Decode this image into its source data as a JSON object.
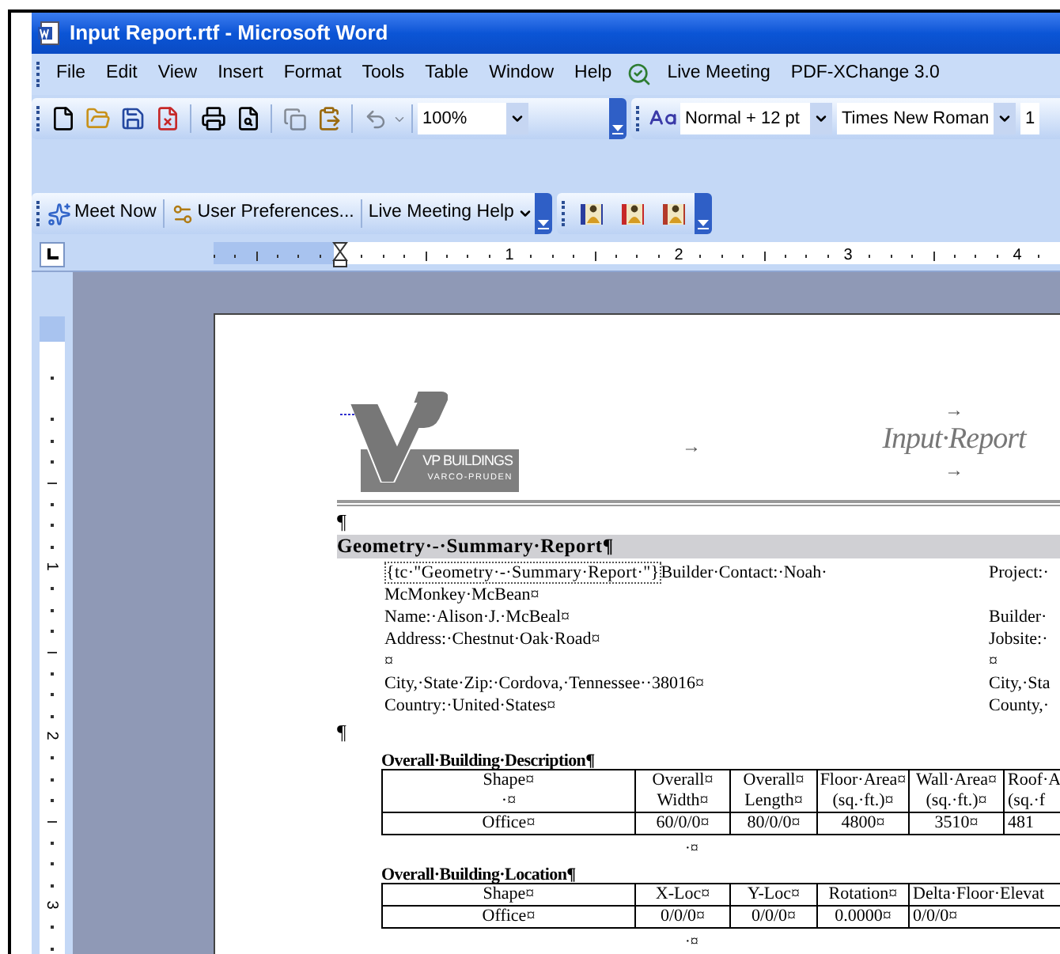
{
  "window": {
    "title": "Input Report.rtf - Microsoft Word"
  },
  "menu": [
    "File",
    "Edit",
    "View",
    "Insert",
    "Format",
    "Tools",
    "Table",
    "Window",
    "Help"
  ],
  "menu_extras": [
    "Live Meeting",
    "PDF-XChange 3.0"
  ],
  "standard_toolbar": {
    "copy_disabled": true,
    "undo_disabled": true,
    "zoom": "100%"
  },
  "formatting_toolbar": {
    "style": "Normal + 12 pt",
    "font": "Times New Roman",
    "font_size": "1"
  },
  "live_meeting_toolbar": {
    "buttons": [
      {
        "label": "Meet Now",
        "kind": "meet"
      },
      {
        "label": "User Preferences...",
        "kind": "preferences"
      },
      {
        "label": "Live Meeting Help",
        "kind": "menu"
      }
    ]
  },
  "ruler": {
    "numbers": [
      "1",
      "2",
      "3",
      "4"
    ]
  },
  "vertical_ruler": {
    "numbers": [
      "1",
      "2",
      "3"
    ]
  },
  "document": {
    "logo": {
      "name": "VP BUILDINGS",
      "tagline": "VARCO-PRUDEN"
    },
    "header": {
      "title": "Input·Report",
      "tab_marks": [
        "→",
        "→",
        "→"
      ]
    },
    "blocks": [
      {
        "kind": "mark",
        "text": "¶"
      },
      {
        "kind": "heading",
        "text": "Geometry·-·Summary·Report¶"
      },
      {
        "kind": "info",
        "field_code": "{tc·\"Geometry·-·Summary·Report·\"}",
        "rows": [
          {
            "left": "Builder·Contact:·Noah·",
            "right": "Project:·"
          },
          {
            "left": "McMonkey·McBean¤"
          },
          {
            "left": "Name:·Alison·J.·McBeal¤",
            "right": "Builder·"
          },
          {
            "left": "Address:·Chestnut·Oak·Road¤",
            "right": "Jobsite:·"
          },
          {
            "left": "¤",
            "right": "¤"
          },
          {
            "left": "City,·State·Zip:·Cordova,·Tennessee··38016¤",
            "right": "City,·Sta"
          },
          {
            "left": "Country:·United·States¤",
            "right": "County,·"
          }
        ]
      },
      {
        "kind": "mark",
        "text": "¶"
      },
      {
        "kind": "subheading",
        "text": "Overall·Building·Description¶"
      },
      {
        "kind": "table",
        "columns": [
          {
            "lines": [
              "Shape¤",
              "·¤"
            ]
          },
          {
            "lines": [
              "Overall¤",
              "Width¤"
            ]
          },
          {
            "lines": [
              "Overall¤",
              "Length¤"
            ]
          },
          {
            "lines": [
              "Floor·Area¤",
              "(sq.·ft.)¤"
            ]
          },
          {
            "lines": [
              "Wall·Area¤",
              "(sq.·ft.)¤"
            ]
          },
          {
            "lines": [
              "Roof·A",
              "(sq.·f"
            ],
            "clipped": true
          }
        ],
        "rows": [
          [
            "Office¤",
            "60/0/0¤",
            "80/0/0¤",
            "4800¤",
            "3510¤",
            "481"
          ]
        ]
      },
      {
        "kind": "end_mark",
        "text": "·¤"
      },
      {
        "kind": "subheading",
        "text": "Overall·Building·Location¶"
      },
      {
        "kind": "table",
        "columns": [
          {
            "lines": [
              "Shape¤"
            ]
          },
          {
            "lines": [
              "X-Loc¤"
            ]
          },
          {
            "lines": [
              "Y-Loc¤"
            ]
          },
          {
            "lines": [
              "Rotation¤"
            ]
          },
          {
            "lines": [
              "Delta·Floor·Elevat"
            ],
            "wide": true,
            "clipped": true
          }
        ],
        "rows": [
          [
            "Office¤",
            "0/0/0¤",
            "0/0/0¤",
            "0.0000¤",
            "0/0/0¤"
          ]
        ]
      },
      {
        "kind": "end_mark",
        "text": "·¤"
      }
    ]
  }
}
